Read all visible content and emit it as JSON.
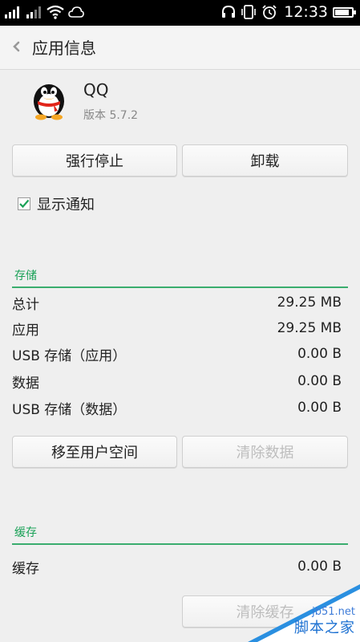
{
  "status_bar": {
    "time": "12:33",
    "battery_level": 0.85,
    "icons": [
      "signal-icon",
      "signal-2-icon",
      "wifi-icon",
      "cloud-icon",
      "headset-icon",
      "phone-vibrate-icon",
      "alarm-icon",
      "battery-icon"
    ]
  },
  "header": {
    "title": "应用信息"
  },
  "app": {
    "name": "QQ",
    "version": "版本 5.7.2"
  },
  "buttons": {
    "force_stop": "强行停止",
    "uninstall": "卸载",
    "move_to_user_space": "移至用户空间",
    "clear_data": "清除数据",
    "clear_cache": "清除缓存"
  },
  "notification": {
    "label": "显示通知",
    "checked": true
  },
  "storage": {
    "title": "存储",
    "rows": [
      {
        "label": "总计",
        "value": "29.25 MB"
      },
      {
        "label": "应用",
        "value": "29.25 MB"
      },
      {
        "label": "USB 存储（应用）",
        "value": "0.00 B"
      },
      {
        "label": "数据",
        "value": "0.00 B"
      },
      {
        "label": "USB 存储（数据）",
        "value": "0.00 B"
      }
    ]
  },
  "cache": {
    "title": "缓存",
    "rows": [
      {
        "label": "缓存",
        "value": "0.00 B"
      }
    ]
  },
  "watermark": {
    "url": "jb51.net",
    "name": "脚本之家"
  },
  "colors": {
    "accent": "#1aa157",
    "status_bar": "#000000",
    "background": "#efefef"
  }
}
